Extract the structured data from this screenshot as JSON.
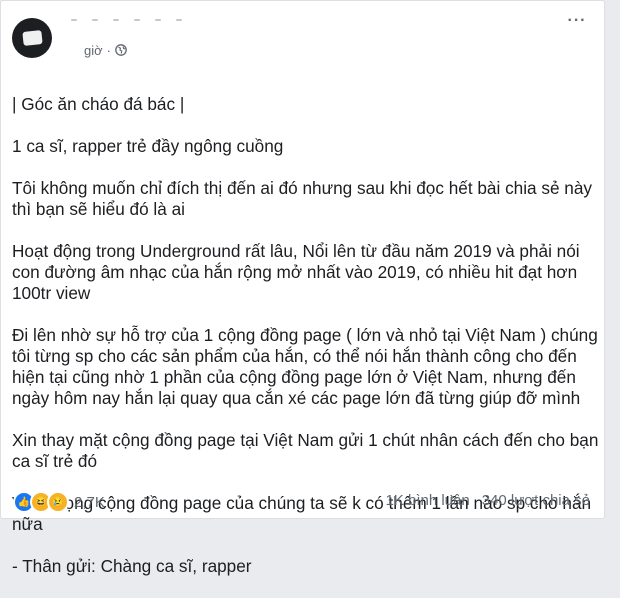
{
  "post": {
    "time_label": "giờ",
    "privacy_icon": "globe-icon",
    "more_label": "···",
    "lines": [
      "| Góc ăn cháo đá bác |",
      "1 ca sĩ, rapper trẻ đầy ngông cuồng",
      "Tôi không muốn chỉ đích thị đến ai đó nhưng sau khi đọc hết bài chia sẻ này thì bạn sẽ hiểu đó là ai",
      "Hoạt động trong Underground rất lâu, Nổi lên từ đầu năm 2019 và phải nói con đường âm nhạc của hắn rộng mở nhất vào 2019, có nhiều hit đạt hơn 100tr view",
      "Đi lên nhờ sự hỗ trợ của 1 cộng đồng page ( lớn và nhỏ tại Việt Nam ) chúng tôi từng sp cho các sản phẩm của hắn, có thể nói hắn thành công cho đến hiện tại cũng nhờ 1 phần của cộng đồng page lớn ở Việt Nam, nhưng đến ngày hôm nay hắn lại quay qua cắn xé các page lớn đã từng giúp đỡ mình",
      "Xin thay mặt cộng đồng page tại Việt Nam gửi 1 chút nhân cách đến cho bạn ca sĩ trẻ đó",
      "Và hi vọng cộng đồng page của chúng ta sẽ k có thêm 1 lần nào sp cho hắn nữa",
      "- Thân gửi: Chàng ca sĩ, rapper"
    ]
  },
  "footer": {
    "reaction_icons": [
      "like-icon",
      "haha-icon",
      "sad-icon"
    ],
    "reaction_count": "2,7K",
    "comments": "1K bình luận",
    "shares": "340 lượt chia sẻ"
  },
  "colors": {
    "text": "#1c1e21",
    "meta": "#616770",
    "like": "#1877f2",
    "emoji": "#f7b125"
  }
}
